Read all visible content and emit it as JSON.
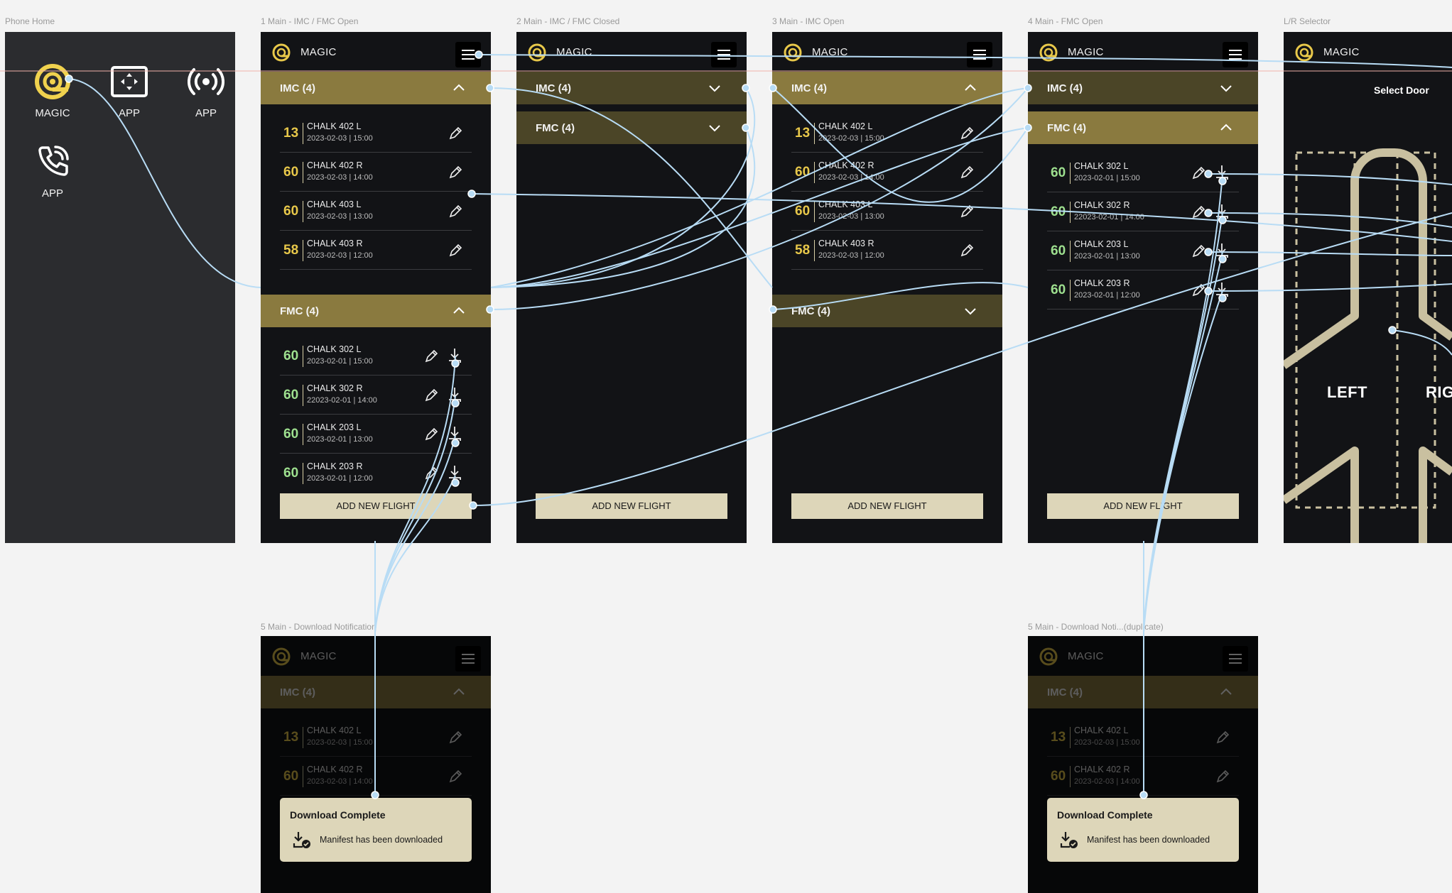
{
  "frames": {
    "phone_home": "Phone Home",
    "s1": "1 Main - IMC / FMC Open",
    "s2": "2 Main - IMC / FMC Closed",
    "s3": "3 Main - IMC Open",
    "s4": "4 Main - FMC Open",
    "lr": "L/R Selector",
    "s5": "5 Main - Download Notification",
    "s6": "5 Main - Download Noti...(duplicate)"
  },
  "home": {
    "apps": [
      {
        "label": "MAGIC",
        "icon": "magic-logo-icon"
      },
      {
        "label": "APP",
        "icon": "expand-screen-icon"
      },
      {
        "label": "APP",
        "icon": "broadcast-icon"
      },
      {
        "label": "APP",
        "icon": "phone-call-icon"
      }
    ]
  },
  "app": {
    "title": "MAGIC",
    "imc_label": "IMC (4)",
    "fmc_label": "FMC (4)",
    "add_label": "ADD NEW FLIGHT"
  },
  "imc_rows": [
    {
      "num": "13",
      "name": "CHALK 402 L",
      "date": "2023-02-03 | 15:00"
    },
    {
      "num": "60",
      "name": "CHALK 402 R",
      "date": "2023-02-03 | 14:00"
    },
    {
      "num": "60",
      "name": "CHALK 403 L",
      "date": "2023-02-03 | 13:00"
    },
    {
      "num": "58",
      "name": "CHALK 403 R",
      "date": "2023-02-03 | 12:00"
    }
  ],
  "fmc_rows": [
    {
      "num": "60",
      "name": "CHALK 302 L",
      "date": "2023-02-01 | 15:00"
    },
    {
      "num": "60",
      "name": "CHALK 302 R",
      "date": "22023-02-01 | 14:00"
    },
    {
      "num": "60",
      "name": "CHALK 203 L",
      "date": "2023-02-01 | 13:00"
    },
    {
      "num": "60",
      "name": "CHALK 203 R",
      "date": "2023-02-01 | 12:00"
    }
  ],
  "selector": {
    "title": "Select Door",
    "left": "LEFT",
    "right": "RIG"
  },
  "toast": {
    "title": "Download Complete",
    "message": "Manifest has been downloaded"
  },
  "colors": {
    "section_open": "#8a7a3f",
    "section_closed": "#4b4527",
    "amber": "#e8c84a",
    "green": "#9ee08f",
    "button": "#ddd6b9",
    "flow_line": "#b8dcf5"
  }
}
